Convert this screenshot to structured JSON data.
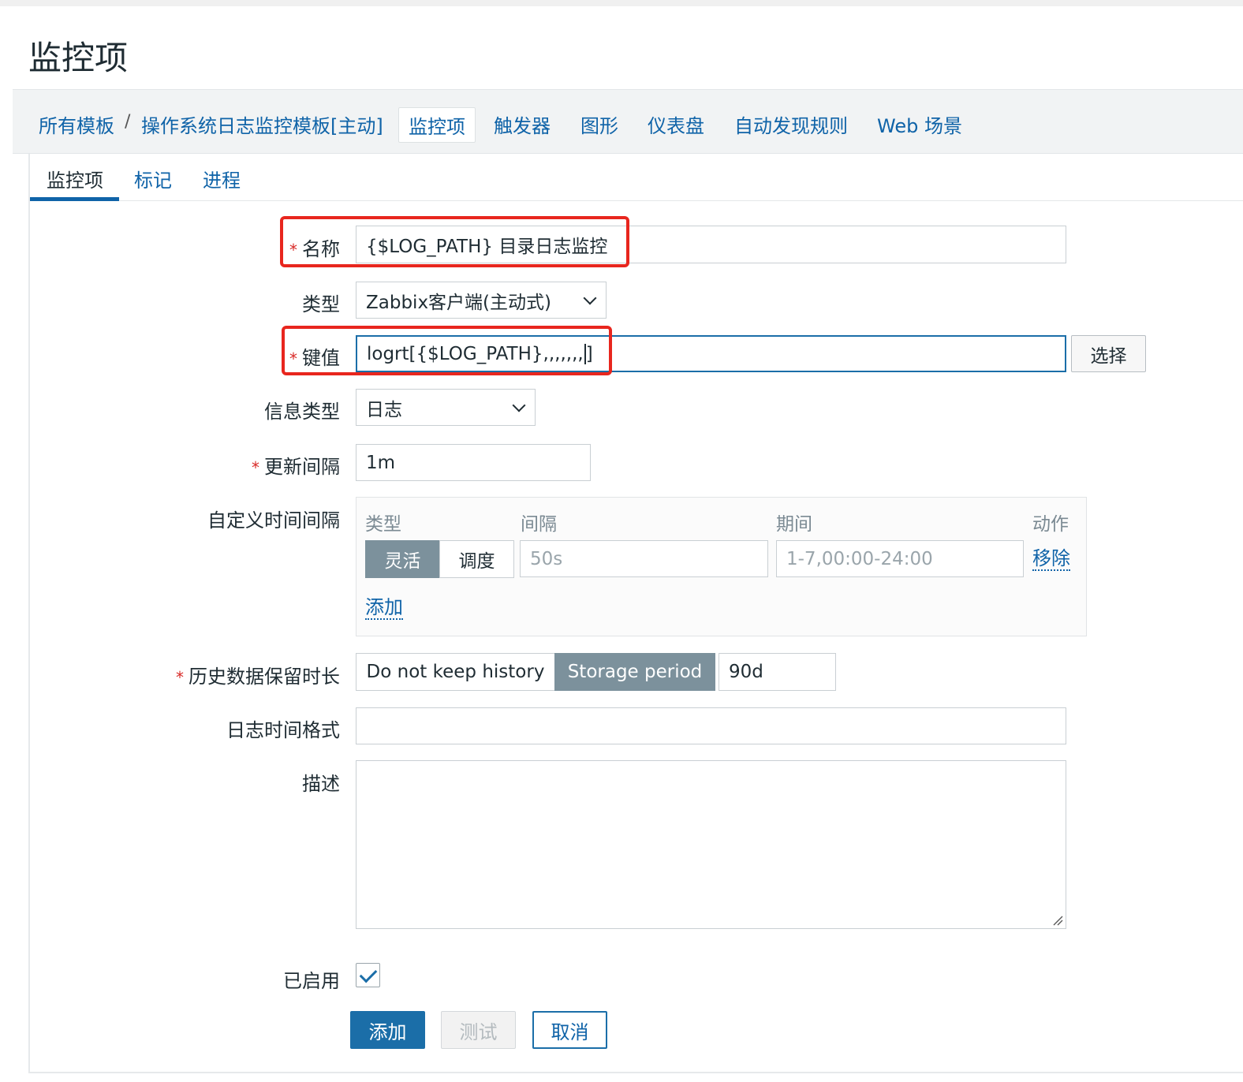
{
  "page": {
    "title": "监控项"
  },
  "breadcrumb": {
    "all_templates": "所有模板",
    "separator": "/",
    "template": "操作系统日志监控模板[主动]"
  },
  "nav": {
    "items": [
      "监控项",
      "触发器",
      "图形",
      "仪表盘",
      "自动发现规则",
      "Web 场景"
    ],
    "active": "监控项"
  },
  "tabs": [
    "监控项",
    "标记",
    "进程"
  ],
  "form": {
    "name": {
      "label": "名称",
      "required": "*",
      "value": "{$LOG_PATH} 目录日志监控"
    },
    "type": {
      "label": "类型",
      "value": "Zabbix客户端(主动式)"
    },
    "key": {
      "label": "键值",
      "required": "*",
      "value": "logrt[{$LOG_PATH},,,,,,,",
      "value_tail": "]",
      "select_button": "选择"
    },
    "info_type": {
      "label": "信息类型",
      "value": "日志"
    },
    "update_interval": {
      "label": "更新间隔",
      "required": "*",
      "value": "1m"
    },
    "custom_intervals": {
      "label": "自定义时间间隔",
      "headers": {
        "type": "类型",
        "interval": "间隔",
        "period": "期间",
        "action": "动作"
      },
      "row": {
        "flexible": "灵活",
        "scheduling": "调度",
        "interval_placeholder": "50s",
        "period_placeholder": "1-7,00:00-24:00",
        "remove": "移除"
      },
      "add": "添加"
    },
    "history": {
      "label": "历史数据保留时长",
      "required": "*",
      "no_keep": "Do not keep history",
      "storage": "Storage period",
      "value": "90d"
    },
    "log_time_format": {
      "label": "日志时间格式",
      "value": ""
    },
    "description": {
      "label": "描述",
      "value": ""
    },
    "enabled": {
      "label": "已启用",
      "checked": true
    }
  },
  "buttons": {
    "add": "添加",
    "test": "测试",
    "cancel": "取消"
  },
  "colors": {
    "accent": "#1b6ea8",
    "highlight": "#e8261e",
    "link": "#0f63a8",
    "required": "#d82a27"
  }
}
